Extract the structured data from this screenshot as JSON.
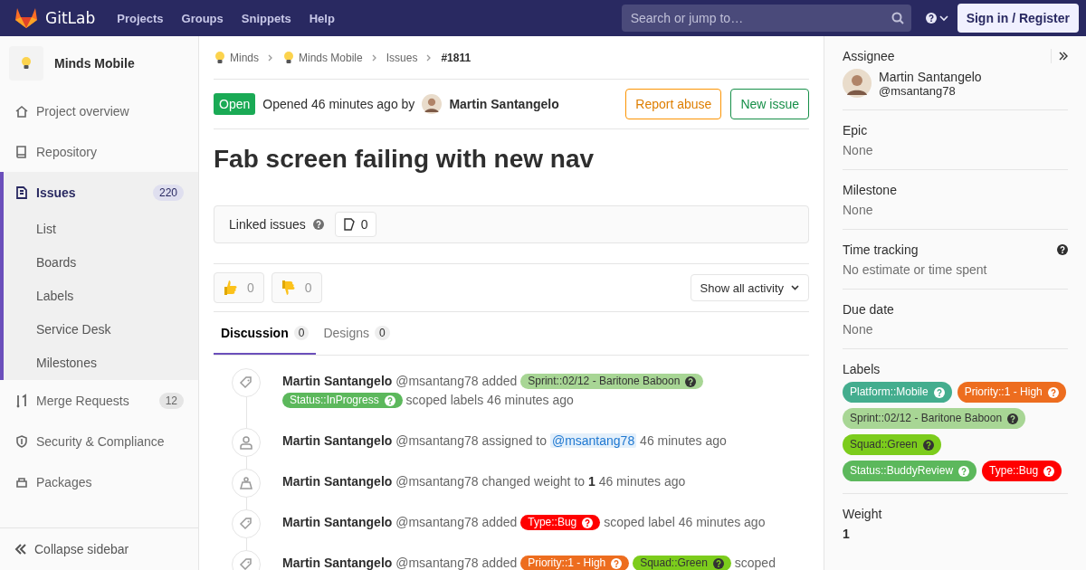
{
  "navbar": {
    "brand": "GitLab",
    "links": [
      "Projects",
      "Groups",
      "Snippets",
      "Help"
    ],
    "search": {
      "placeholder": "Search or jump to…"
    },
    "sign_in": "Sign in / Register"
  },
  "sidebar": {
    "project": "Minds Mobile",
    "items": [
      {
        "label": "Project overview",
        "selected": false
      },
      {
        "label": "Repository",
        "selected": false
      },
      {
        "label": "Issues",
        "count": "220",
        "selected": true,
        "children": [
          {
            "label": "List"
          },
          {
            "label": "Boards"
          },
          {
            "label": "Labels"
          },
          {
            "label": "Service Desk"
          },
          {
            "label": "Milestones"
          }
        ]
      },
      {
        "label": "Merge Requests",
        "count": "12",
        "selected": false
      },
      {
        "label": "Security & Compliance",
        "selected": false
      },
      {
        "label": "Packages",
        "selected": false
      }
    ],
    "collapse": "Collapse sidebar"
  },
  "breadcrumbs": [
    {
      "kind": "project",
      "text": "Minds"
    },
    {
      "kind": "project",
      "text": "Minds Mobile"
    },
    {
      "kind": "link",
      "text": "Issues"
    },
    {
      "kind": "current",
      "text": "#1811"
    }
  ],
  "issue": {
    "status": "Open",
    "opened": "Opened 46 minutes ago by",
    "author": "Martin Santangelo",
    "buttons": [
      {
        "kind": "warning",
        "label": "Report abuse"
      },
      {
        "kind": "success",
        "label": "New issue"
      }
    ],
    "title": "Fab screen failing with new nav",
    "linked": {
      "label": "Linked issues",
      "count": "0"
    },
    "awards": [
      {
        "kind": "thumbsup",
        "count": "0"
      },
      {
        "kind": "thumbsdown",
        "count": "0"
      }
    ],
    "filter": "Show all activity",
    "tabs": [
      {
        "label": "Discussion",
        "count": "0",
        "selected": true
      },
      {
        "label": "Designs",
        "count": "0",
        "selected": false
      }
    ],
    "activity": [
      {
        "kind": "tag",
        "author": "Martin Santangelo",
        "username": "@msantang78",
        "parts": [
          {
            "kind": "text",
            "text": "added"
          },
          {
            "kind": "label",
            "text": "Sprint::02/12 - Baritone Baboon",
            "color": "#a8d695"
          },
          {
            "kind": "label",
            "text": "Status::InProgress",
            "color": "#5cb85c"
          },
          {
            "kind": "text",
            "text": "scoped labels 46 minutes ago"
          }
        ]
      },
      {
        "kind": "user",
        "author": "Martin Santangelo",
        "username": "@msantang78",
        "parts": [
          {
            "kind": "text",
            "text": "assigned to"
          },
          {
            "kind": "mention",
            "text": "@msantang78"
          },
          {
            "kind": "text",
            "text": "46 minutes ago"
          }
        ]
      },
      {
        "kind": "weight",
        "author": "Martin Santangelo",
        "username": "@msantang78",
        "parts": [
          {
            "kind": "text",
            "text": "changed weight to"
          },
          {
            "kind": "bold",
            "text": "1"
          },
          {
            "kind": "text",
            "text": "46 minutes ago"
          }
        ]
      },
      {
        "kind": "tag",
        "author": "Martin Santangelo",
        "username": "@msantang78",
        "parts": [
          {
            "kind": "text",
            "text": "added"
          },
          {
            "kind": "label",
            "text": "Type::Bug",
            "color": "#ff0000"
          },
          {
            "kind": "text",
            "text": "scoped label 46 minutes ago"
          }
        ]
      },
      {
        "kind": "tag",
        "author": "Martin Santangelo",
        "username": "@msantang78",
        "parts": [
          {
            "kind": "text",
            "text": "added"
          },
          {
            "kind": "label",
            "text": "Priority::1 - High",
            "color": "#ed6d1f"
          },
          {
            "kind": "label",
            "text": "Squad::Green",
            "color": "#7ccc1c"
          },
          {
            "kind": "text",
            "text": "scoped"
          }
        ]
      }
    ]
  },
  "right_sidebar": {
    "assignee": {
      "heading": "Assignee",
      "name": "Martin Santangelo",
      "username": "@msantang78"
    },
    "sections": [
      {
        "kind": "value",
        "heading": "Epic",
        "value": "None"
      },
      {
        "kind": "value",
        "heading": "Milestone",
        "value": "None"
      },
      {
        "kind": "help",
        "heading": "Time tracking",
        "value": "No estimate or time spent"
      },
      {
        "kind": "value",
        "heading": "Due date",
        "value": "None"
      }
    ],
    "labels": {
      "heading": "Labels",
      "items": [
        {
          "text": "Platform::Mobile",
          "color": "#44ad8e"
        },
        {
          "text": "Priority::1 - High",
          "color": "#ed6d1f"
        },
        {
          "text": "Sprint::02/12 - Baritone Baboon",
          "color": "#a8d695"
        },
        {
          "text": "Squad::Green",
          "color": "#7ccc1c"
        },
        {
          "text": "Status::BuddyReview",
          "color": "#5cb85c"
        },
        {
          "text": "Type::Bug",
          "color": "#ff0000"
        }
      ]
    },
    "weight": {
      "heading": "Weight",
      "value": "1"
    }
  }
}
